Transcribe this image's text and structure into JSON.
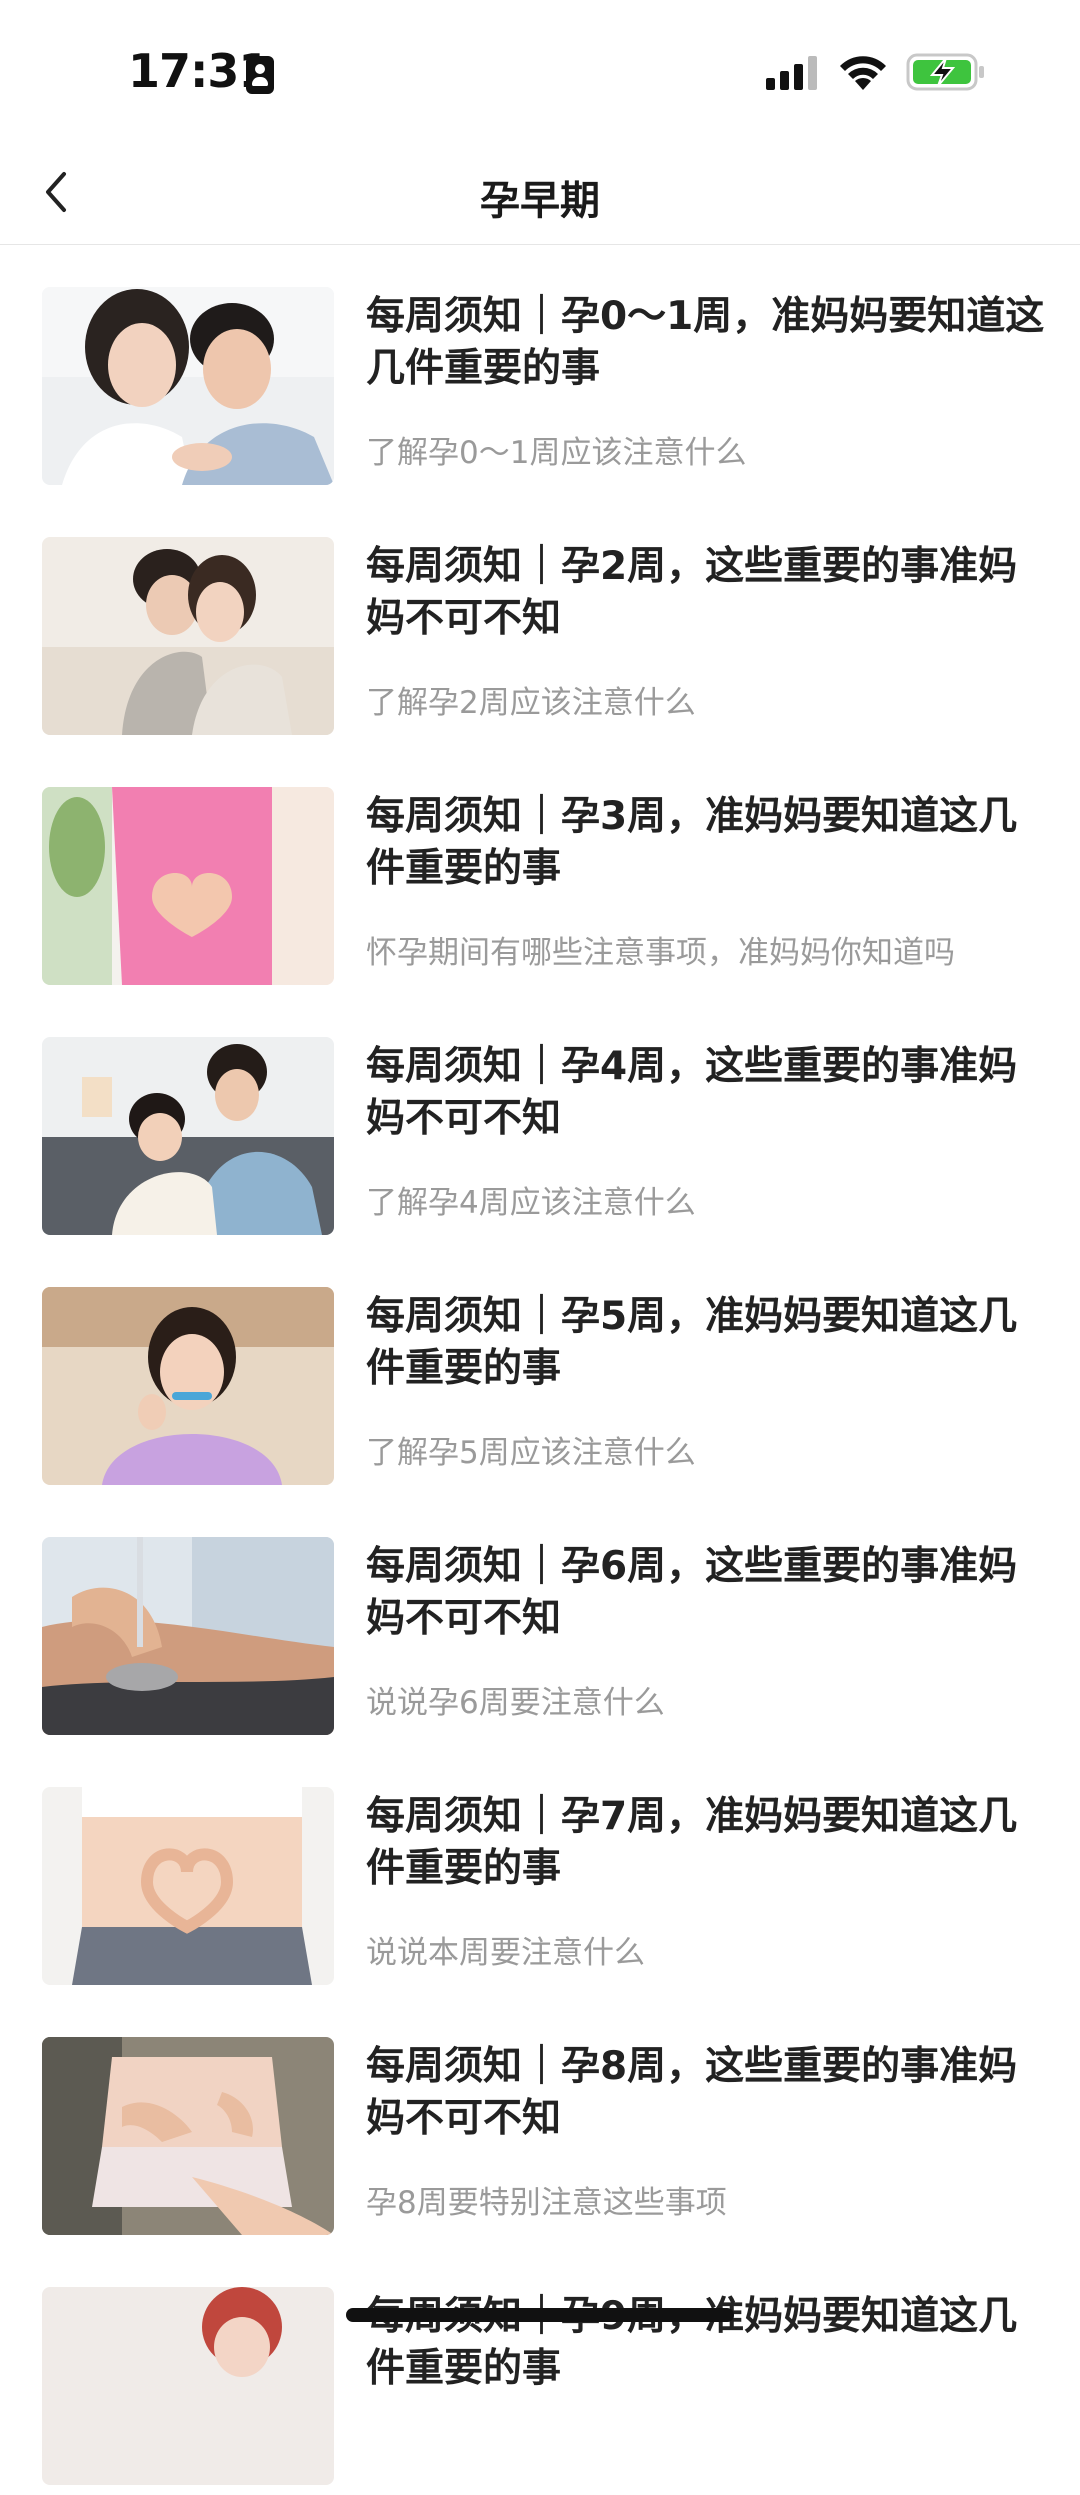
{
  "status_bar": {
    "time": "17:31",
    "icons": [
      "id-card-icon",
      "cellular-signal-icon",
      "wifi-icon",
      "battery-charging-icon"
    ],
    "battery_color": "#3ec43e"
  },
  "nav": {
    "back_icon": "chevron-left-icon",
    "title": "孕早期"
  },
  "articles": [
    {
      "title": "每周须知｜孕0～1周，准妈妈要知道这几件重要的事",
      "subtitle": "了解孕0～1周应该注意什么",
      "image": "couple-embracing-photo"
    },
    {
      "title": "每周须知｜孕2周，这些重要的事准妈妈不可不知",
      "subtitle": "了解孕2周应该注意什么",
      "image": "couple-hugging-photo"
    },
    {
      "title": "每周须知｜孕3周，准妈妈要知道这几件重要的事",
      "subtitle": "怀孕期间有哪些注意事项，准妈妈你知道吗",
      "image": "heart-hands-pink-belly-photo"
    },
    {
      "title": "每周须知｜孕4周，这些重要的事准妈妈不可不知",
      "subtitle": "了解孕4周应该注意什么",
      "image": "couple-pregnancy-test-photo"
    },
    {
      "title": "每周须知｜孕5周，准妈妈要知道这几件重要的事",
      "subtitle": "了解孕5周应该注意什么",
      "image": "woman-pregnancy-test-photo"
    },
    {
      "title": "每周须知｜孕6周，这些重要的事准妈妈不可不知",
      "subtitle": "说说孕6周要注意什么",
      "image": "ultrasound-scan-photo"
    },
    {
      "title": "每周须知｜孕7周，准妈妈要知道这几件重要的事",
      "subtitle": "说说本周要注意什么",
      "image": "heart-hands-belly-photo"
    },
    {
      "title": "每周须知｜孕8周，这些重要的事准妈妈不可不知",
      "subtitle": "孕8周要特别注意这些事项",
      "image": "hands-on-belly-photo"
    },
    {
      "title": "每周须知｜孕9周，准妈妈要知道这几件重要的事",
      "subtitle": "",
      "image": "woman-portrait-photo"
    }
  ]
}
